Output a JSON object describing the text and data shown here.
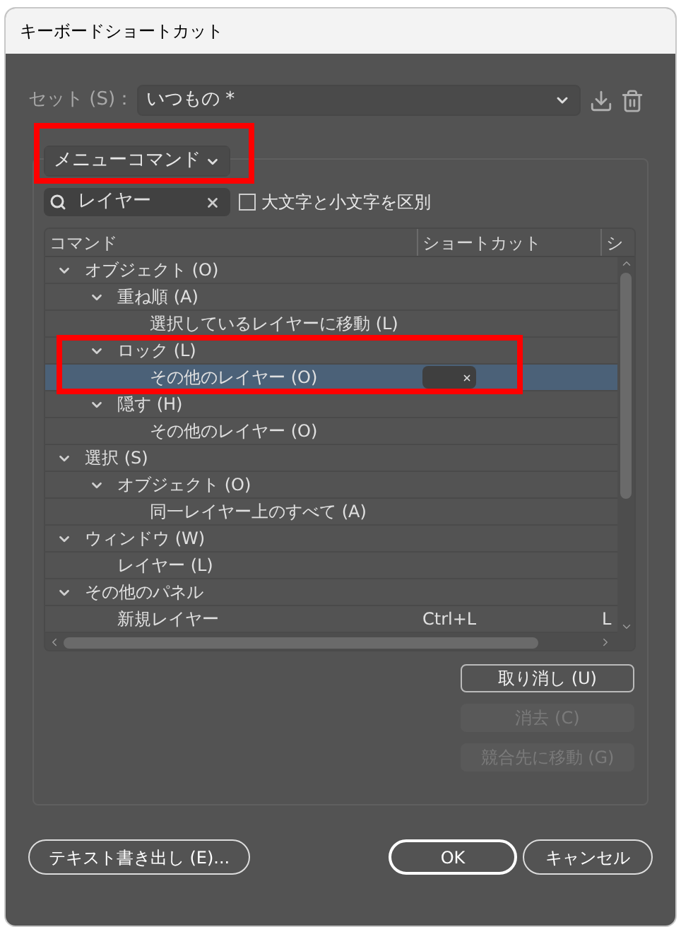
{
  "window": {
    "title": "キーボードショートカット"
  },
  "set": {
    "label": "セット (S)：",
    "value": "いつもの *"
  },
  "category": {
    "value": "メニューコマンド",
    "highlighted": true
  },
  "search": {
    "value": "レイヤー"
  },
  "case_checkbox": {
    "label": "大文字と小文字を区別",
    "checked": false
  },
  "table": {
    "columns": [
      "コマンド",
      "ショートカット",
      "シ"
    ],
    "tree": [
      {
        "label": "オブジェクト (O)",
        "expanded": true,
        "highlighted": false,
        "children": [
          {
            "label": "重ね順 (A)",
            "expanded": true,
            "highlighted": false,
            "children": [
              {
                "label": "選択しているレイヤーに移動 (L)",
                "selected": false
              }
            ]
          },
          {
            "label": "ロック (L)",
            "expanded": true,
            "highlighted": true,
            "children": [
              {
                "label": "その他のレイヤー (O)",
                "selected": true,
                "editing": true
              }
            ]
          },
          {
            "label": "隠す (H)",
            "expanded": true,
            "highlighted": false,
            "children": [
              {
                "label": "その他のレイヤー (O)",
                "selected": false
              }
            ]
          }
        ]
      },
      {
        "label": "選択 (S)",
        "expanded": true,
        "highlighted": false,
        "children": [
          {
            "label": "オブジェクト (O)",
            "expanded": true,
            "highlighted": false,
            "children": [
              {
                "label": "同一レイヤー上のすべて (A)",
                "selected": false
              }
            ]
          }
        ]
      },
      {
        "label": "ウィンドウ (W)",
        "expanded": true,
        "highlighted": false,
        "children": [
          {
            "label": "レイヤー (L)",
            "selected": false
          }
        ]
      },
      {
        "label": "その他のパネル",
        "expanded": true,
        "highlighted": false,
        "children": [
          {
            "label": "新規レイヤー",
            "selected": false,
            "shortcut": "Ctrl+L",
            "column_3": "L"
          }
        ]
      }
    ]
  },
  "side_buttons": [
    {
      "label": "取り消し (U)",
      "disabled": false
    },
    {
      "label": "消去 (C)",
      "disabled": true
    },
    {
      "label": "競合先に移動 (G)",
      "disabled": true
    }
  ],
  "footer_buttons": [
    {
      "label": "テキスト書き出し (E)...",
      "default": false
    },
    {
      "label": "OK",
      "default": true
    },
    {
      "label": "キャンセル",
      "default": false
    }
  ]
}
